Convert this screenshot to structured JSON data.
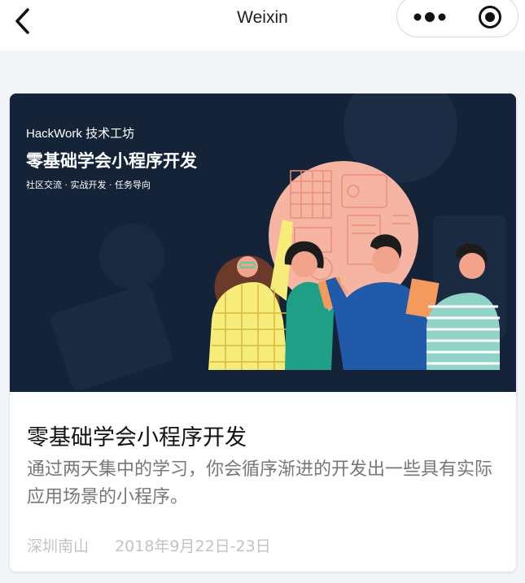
{
  "nav": {
    "title": "Weixin",
    "back_icon": "chevron-left-icon",
    "more_icon": "more-dots-icon",
    "close_icon": "target-close-icon"
  },
  "card": {
    "banner": {
      "brand": "HackWork 技术工坊",
      "title": "零基础学会小程序开发",
      "tagline": "社区交流 · 实战开发 · 任务导向",
      "background": "#152338",
      "accent": "#f6b4a2"
    },
    "title": "零基础学会小程序开发",
    "description": "通过两天集中的学习，你会循序渐进的开发出一些具有实际应用场景的小程序。",
    "location": "深圳南山",
    "date": "2018年9月22日-23日"
  },
  "colors": {
    "page_bg": "#f3f5f8",
    "title_text": "#111111",
    "desc_text": "#777777",
    "meta_text": "#c3c3c3"
  }
}
